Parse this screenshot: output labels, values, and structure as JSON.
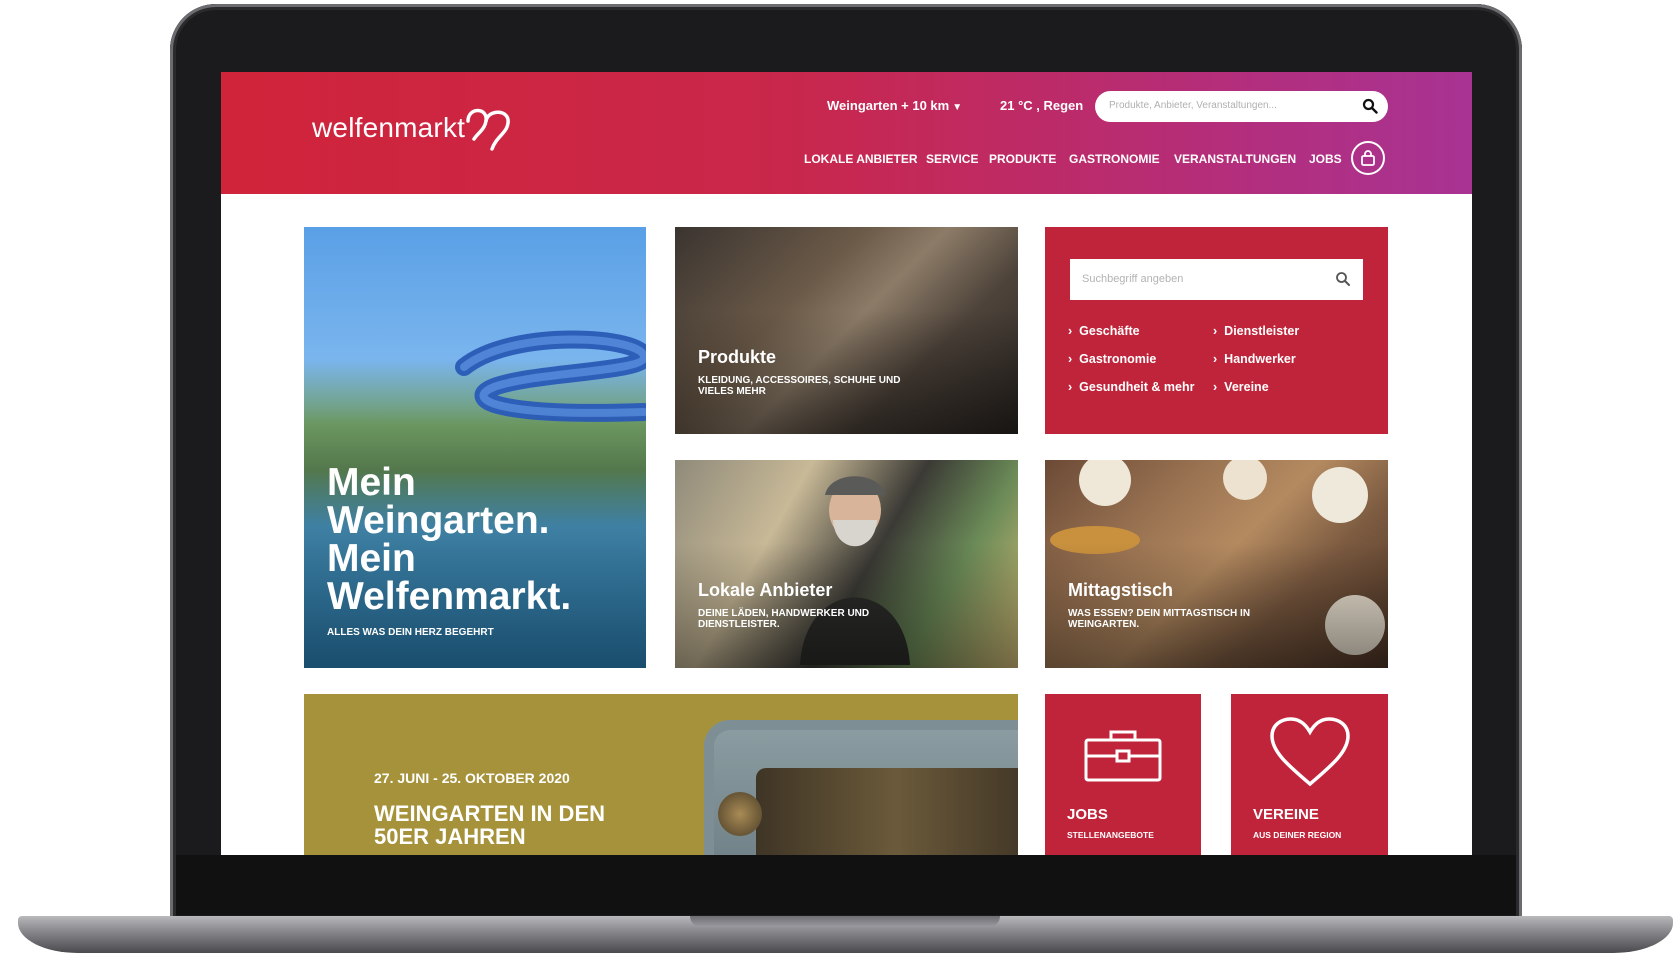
{
  "header": {
    "logo_text": "welfenmarkt",
    "location": "Weingarten + 10 km",
    "weather": "21 °C , Regen",
    "search_placeholder": "Produkte, Anbieter, Veranstaltungen...",
    "nav": [
      "LOKALE ANBIETER",
      "SERVICE",
      "PRODUKTE",
      "GASTRONOMIE",
      "VERANSTALTUNGEN",
      "JOBS"
    ]
  },
  "hero": {
    "title": "Mein Weingarten. Mein Welfenmarkt.",
    "subtitle": "ALLES WAS DEIN HERZ BEGEHRT"
  },
  "produkte": {
    "title": "Produkte",
    "subtitle": "KLEIDUNG, ACCESSOIRES, SCHUHE UND VIELES MEHR"
  },
  "directory": {
    "search_placeholder": "Suchbegriff angeben",
    "categories": [
      "Geschäfte",
      "Gastronomie",
      "Gesundheit & mehr",
      "Dienstleister",
      "Handwerker",
      "Vereine"
    ]
  },
  "lokal": {
    "title": "Lokale Anbieter",
    "subtitle": "DEINE LÄDEN, HANDWERKER UND DIENSTLEISTER."
  },
  "mittag": {
    "title": "Mittagstisch",
    "subtitle": "WAS ESSEN? DEIN MITTAGSTISCH IN WEINGARTEN."
  },
  "event": {
    "date": "27. JUNI - 25. OKTOBER 2020",
    "title": "WEINGARTEN IN DEN 50ER JAHREN"
  },
  "jobs": {
    "title": "JOBS",
    "subtitle": "STELLENANGEBOTE"
  },
  "vereine": {
    "title": "VEREINE",
    "subtitle": "AUS DEINER REGION"
  },
  "colors": {
    "header_start": "#d0243a",
    "header_end": "#a83393",
    "brand_red": "#c0243a",
    "event_olive": "#a5923a"
  },
  "icons": [
    "logo-hearts-icon",
    "caret-down-icon",
    "search-icon",
    "basket-icon",
    "briefcase-icon",
    "heart-icon"
  ]
}
